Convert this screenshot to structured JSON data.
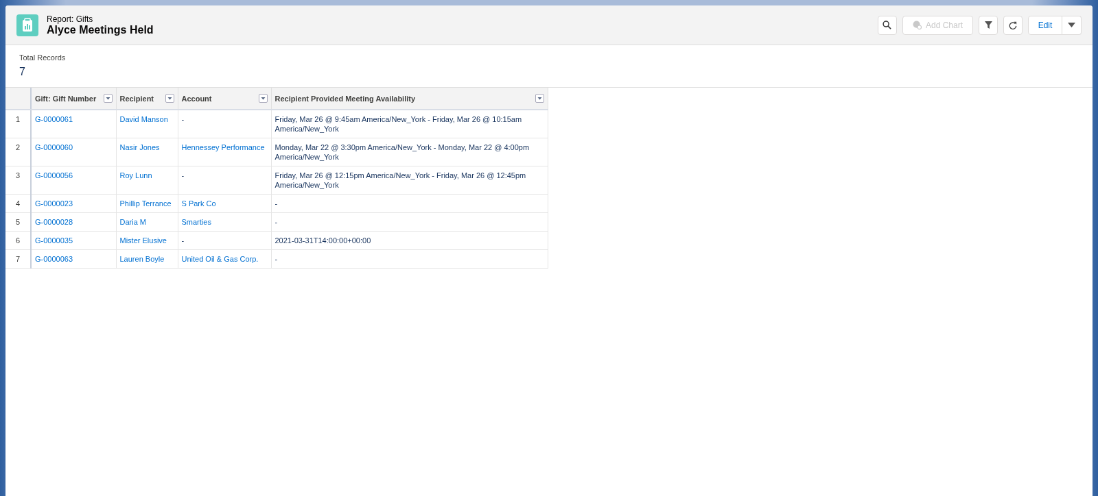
{
  "header": {
    "subtitle": "Report: Gifts",
    "title": "Alyce Meetings Held"
  },
  "toolbar": {
    "add_chart": {
      "label": "Add Chart",
      "disabled": true
    },
    "edit": {
      "label": "Edit"
    }
  },
  "summary": {
    "label": "Total Records",
    "value": "7"
  },
  "table": {
    "columns": [
      "Gift: Gift Number",
      "Recipient",
      "Account",
      "Recipient Provided Meeting Availability"
    ],
    "rows": [
      {
        "number": "1",
        "gift": "G-0000061",
        "recipient": "David Manson",
        "account": "-",
        "account_link": false,
        "availability": "Friday, Mar 26 @ 9:45am America/New_York - Friday, Mar 26 @ 10:15am America/New_York"
      },
      {
        "number": "2",
        "gift": "G-0000060",
        "recipient": "Nasir Jones",
        "account": "Hennessey Performance",
        "account_link": true,
        "availability": "Monday, Mar 22 @ 3:30pm America/New_York - Monday, Mar 22 @ 4:00pm America/New_York"
      },
      {
        "number": "3",
        "gift": "G-0000056",
        "recipient": "Roy Lunn",
        "account": "-",
        "account_link": false,
        "availability": "Friday, Mar 26 @ 12:15pm America/New_York - Friday, Mar 26 @ 12:45pm America/New_York"
      },
      {
        "number": "4",
        "gift": "G-0000023",
        "recipient": "Phillip Terrance",
        "account": "S Park Co",
        "account_link": true,
        "availability": "-"
      },
      {
        "number": "5",
        "gift": "G-0000028",
        "recipient": "Daria M",
        "account": "Smarties",
        "account_link": true,
        "availability": "-"
      },
      {
        "number": "6",
        "gift": "G-0000035",
        "recipient": "Mister Elusive",
        "account": "-",
        "account_link": false,
        "availability": "2021-03-31T14:00:00+00:00"
      },
      {
        "number": "7",
        "gift": "G-0000063",
        "recipient": "Lauren Boyle",
        "account": "United Oil & Gas Corp.",
        "account_link": true,
        "availability": "-"
      }
    ]
  }
}
